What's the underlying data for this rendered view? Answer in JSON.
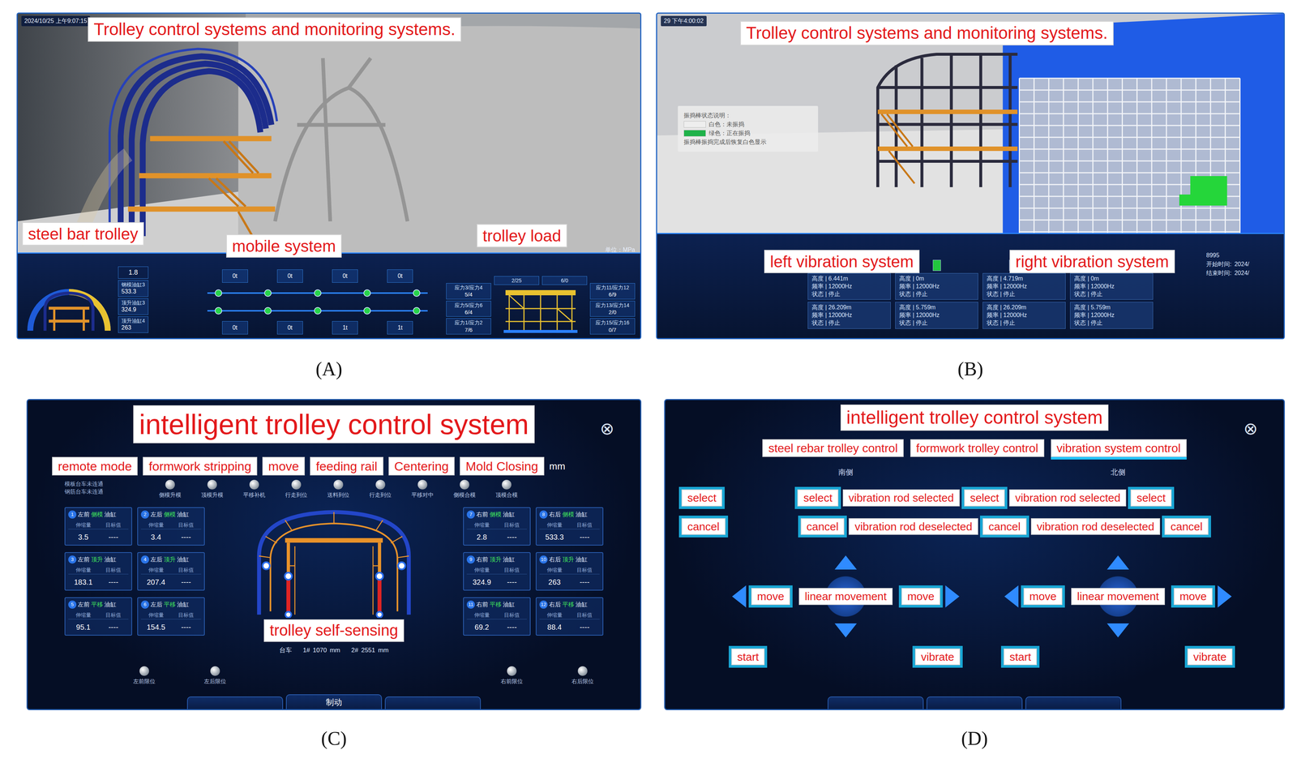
{
  "panel_a": {
    "caption": "(A)",
    "timestamp": "2024/10/25 上午9:07:15",
    "title": "Trolley control systems and monitoring systems.",
    "steel_bar_label": "steel bar trolley",
    "mobile_label": "mobile system",
    "load_label": "trolley load",
    "unit": "单位：MPa",
    "gauge": {
      "top_value": "1.8",
      "readings": [
        {
          "label": "钢模油缸3",
          "value": "533.3"
        },
        {
          "label": "顶升油缸3",
          "value": "324.9"
        },
        {
          "label": "顶升油缸4",
          "value": "263"
        }
      ]
    },
    "mobile": {
      "top": [
        "0t",
        "0t",
        "0t",
        "0t"
      ],
      "bottom": [
        "0t",
        "0t",
        "1t",
        "1t"
      ],
      "tracks": [
        {
          "nodes": [
            {
              "on": true
            },
            {
              "on": true
            },
            {
              "on": true
            },
            {
              "on": true
            },
            {
              "on": true
            }
          ]
        },
        {
          "nodes": [
            {
              "on": true
            },
            {
              "on": true
            },
            {
              "on": true
            },
            {
              "on": true
            },
            {
              "on": true
            }
          ]
        }
      ]
    },
    "load": {
      "top": [
        "2/25",
        "6/0"
      ],
      "left": [
        {
          "label": "应力3/应力4",
          "value": "5/4"
        },
        {
          "label": "应力5/应力6",
          "value": "6/4"
        },
        {
          "label": "应力1/应力2",
          "value": "7/6"
        }
      ],
      "right": [
        {
          "label": "应力11/应力12",
          "value": "6/9"
        },
        {
          "label": "应力13/应力14",
          "value": "2/0"
        },
        {
          "label": "应力15/应力16",
          "value": "0/7"
        }
      ]
    }
  },
  "panel_b": {
    "caption": "(B)",
    "timestamp": "29 下午4:00:02",
    "title": "Trolley control systems and monitoring systems.",
    "legend": {
      "heading": "振捣棒状态说明：",
      "items": [
        {
          "text": "白色：未振捣",
          "color": "#eeeeee"
        },
        {
          "text": "绿色：正在振捣",
          "color": "#1fb24a"
        }
      ],
      "note": "振捣棒振捣完成后恢复白色显示"
    },
    "left_label": "left vibration system",
    "right_label": "right vibration system",
    "columns": [
      {
        "lamps": [
          {
            "on": true
          },
          {
            "on": true
          },
          {
            "on": true
          }
        ],
        "rods": [
          {
            "height": "高度 | 6.441m",
            "freq": "频率 | 12000Hz",
            "state": "状态 | 停止"
          },
          {
            "height": "高度 | 26.209m",
            "freq": "频率 | 12000Hz",
            "state": "状态 | 停止"
          }
        ]
      },
      {
        "lamps": [
          {
            "on": true
          }
        ],
        "rods": [
          {
            "height": "高度 | 0m",
            "freq": "频率 | 12000Hz",
            "state": "状态 | 停止"
          },
          {
            "height": "高度 | 5.759m",
            "freq": "频率 | 12000Hz",
            "state": "状态 | 停止"
          }
        ]
      },
      {
        "lamps": [
          {
            "on": true
          },
          {
            "on": true
          },
          {
            "on": true
          }
        ],
        "rods": [
          {
            "height": "高度 | 4.719m",
            "freq": "频率 | 12000Hz",
            "state": "状态 | 停止"
          },
          {
            "height": "高度 | 26.209m",
            "freq": "频率 | 12000Hz",
            "state": "状态 | 停止"
          }
        ]
      },
      {
        "lamps": [
          {
            "on": true
          }
        ],
        "rods": [
          {
            "height": "高度 | 0m",
            "freq": "频率 | 12000Hz",
            "state": "状态 | 停止"
          },
          {
            "height": "高度 | 5.759m",
            "freq": "频率 | 12000Hz",
            "state": "状态 | 停止"
          }
        ]
      }
    ],
    "info": {
      "value": "8995",
      "start_label": "开始时间:",
      "start": "2024/",
      "end_label": "结束时间:",
      "end": "2024/"
    }
  },
  "panel_c": {
    "caption": "(C)",
    "title": "intelligent trolley control system",
    "close": "⊗",
    "steps": [
      "remote mode",
      "formwork stripping",
      "move",
      "feeding rail",
      "Centering",
      "Mold Closing"
    ],
    "unit": "mm",
    "connections": [
      "模板台车未连通",
      "钢筋台车未连通"
    ],
    "indicators": [
      {
        "label": "侧模升模",
        "on": false
      },
      {
        "label": "顶模升模",
        "on": false
      },
      {
        "label": "平移补机",
        "on": false
      },
      {
        "label": "行走到位",
        "on": false
      },
      {
        "label": "送料到位",
        "on": false
      },
      {
        "label": "行走到位",
        "on": false
      },
      {
        "label": "平移对中",
        "on": false
      },
      {
        "label": "侧模合模",
        "on": false
      },
      {
        "label": "顶模合模",
        "on": false
      }
    ],
    "left_cards": [
      {
        "no": "1",
        "pos": "左前",
        "part": "侧模",
        "tag": "油缸",
        "key": "伸缩量",
        "target_key": "目标值",
        "value": "3.5",
        "target": "----"
      },
      {
        "no": "2",
        "pos": "左后",
        "part": "侧模",
        "tag": "油缸",
        "key": "伸缩量",
        "target_key": "目标值",
        "value": "3.4",
        "target": "----"
      },
      {
        "no": "3",
        "pos": "左前",
        "part": "顶升",
        "tag": "油缸",
        "key": "伸缩量",
        "target_key": "目标值",
        "value": "183.1",
        "target": "----"
      },
      {
        "no": "4",
        "pos": "左后",
        "part": "顶升",
        "tag": "油缸",
        "key": "伸缩量",
        "target_key": "目标值",
        "value": "207.4",
        "target": "----"
      },
      {
        "no": "5",
        "pos": "左前",
        "part": "平移",
        "tag": "油缸",
        "key": "伸缩量",
        "target_key": "目标值",
        "value": "95.1",
        "target": "----"
      },
      {
        "no": "6",
        "pos": "左后",
        "part": "平移",
        "tag": "油缸",
        "key": "伸缩量",
        "target_key": "目标值",
        "value": "154.5",
        "target": "----"
      }
    ],
    "right_cards": [
      {
        "no": "7",
        "pos": "右前",
        "part": "侧模",
        "tag": "油缸",
        "key": "伸缩量",
        "target_key": "目标值",
        "value": "2.8",
        "target": "----"
      },
      {
        "no": "8",
        "pos": "右后",
        "part": "侧模",
        "tag": "油缸",
        "key": "伸缩量",
        "target_key": "目标值",
        "value": "533.3",
        "target": "----"
      },
      {
        "no": "9",
        "pos": "右前",
        "part": "顶升",
        "tag": "油缸",
        "key": "伸缩量",
        "target_key": "目标值",
        "value": "324.9",
        "target": "----"
      },
      {
        "no": "10",
        "pos": "右后",
        "part": "顶升",
        "tag": "油缸",
        "key": "伸缩量",
        "target_key": "目标值",
        "value": "263",
        "target": "----"
      },
      {
        "no": "11",
        "pos": "右前",
        "part": "平移",
        "tag": "油缸",
        "key": "伸缩量",
        "target_key": "目标值",
        "value": "69.2",
        "target": "----"
      },
      {
        "no": "12",
        "pos": "右后",
        "part": "平移",
        "tag": "油缸",
        "key": "伸缩量",
        "target_key": "目标值",
        "value": "88.4",
        "target": "----"
      }
    ],
    "self_sensing": "trolley self-sensing",
    "sensing_title": "台车",
    "sensing": [
      {
        "label": "1#",
        "value": "1070",
        "unit": "mm"
      },
      {
        "label": "2#",
        "value": "2551",
        "unit": "mm"
      }
    ],
    "limits_left": [
      {
        "label": "左前限位",
        "on": false
      },
      {
        "label": "左后限位",
        "on": false
      }
    ],
    "limits_right": [
      {
        "label": "右前限位",
        "on": false
      },
      {
        "label": "右后限位",
        "on": false
      }
    ],
    "brake": "制动"
  },
  "panel_d": {
    "caption": "(D)",
    "title": "intelligent trolley control system",
    "close": "⊗",
    "tabs": [
      {
        "label": "steel rebar trolley control",
        "selected": false
      },
      {
        "label": "formwork trolley control",
        "selected": false
      },
      {
        "label": "vibration system control",
        "selected": true
      }
    ],
    "sides": [
      "南侧",
      "北侧"
    ],
    "select_row": [
      {
        "text": "select",
        "kind": "button"
      },
      {
        "text": "select",
        "kind": "button"
      },
      {
        "text": "vibration rod selected",
        "kind": "label"
      },
      {
        "text": "select",
        "kind": "button"
      },
      {
        "text": "vibration rod selected",
        "kind": "label"
      },
      {
        "text": "select",
        "kind": "button"
      }
    ],
    "cancel_row": [
      {
        "text": "cancel",
        "kind": "button"
      },
      {
        "text": "cancel",
        "kind": "button"
      },
      {
        "text": "vibration rod deselected",
        "kind": "label"
      },
      {
        "text": "cancel",
        "kind": "button"
      },
      {
        "text": "vibration rod deselected",
        "kind": "label"
      },
      {
        "text": "cancel",
        "kind": "button"
      }
    ],
    "pads": [
      {
        "left": "move",
        "center": "linear movement",
        "right": "move",
        "start": "start",
        "vibrate": "vibrate"
      },
      {
        "left": "move",
        "center": "linear movement",
        "right": "move",
        "start": "start",
        "vibrate": "vibrate"
      }
    ]
  }
}
